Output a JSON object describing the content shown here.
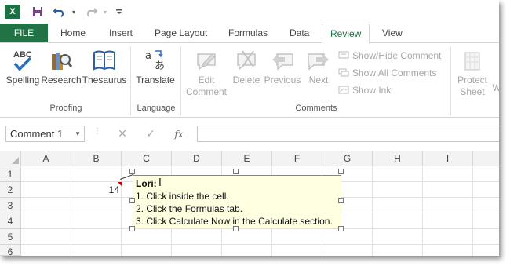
{
  "qat": {
    "app_logo": "X",
    "icons": [
      "save-icon",
      "undo-icon",
      "redo-icon",
      "customize-icon"
    ]
  },
  "tabs": {
    "file": "FILE",
    "items": [
      "Home",
      "Insert",
      "Page Layout",
      "Formulas",
      "Data",
      "Review",
      "View"
    ],
    "active": "Review"
  },
  "ribbon": {
    "proofing": {
      "label": "Proofing",
      "spelling": "Spelling",
      "research": "Research",
      "thesaurus": "Thesaurus",
      "abc": "ABC"
    },
    "language": {
      "label": "Language",
      "translate": "Translate"
    },
    "comments": {
      "label": "Comments",
      "edit_line1": "Edit",
      "edit_line2": "Comment",
      "delete": "Delete",
      "previous": "Previous",
      "next": "Next",
      "show_hide": "Show/Hide Comment",
      "show_all": "Show All Comments",
      "show_ink": "Show Ink"
    },
    "changes": {
      "protect_line1": "Protect",
      "protect_line2": "Sheet",
      "partial": "W"
    }
  },
  "formula_bar": {
    "name_box": "Comment 1",
    "cancel": "✕",
    "enter": "✓",
    "fx": "fx",
    "value": ""
  },
  "grid": {
    "columns": [
      "A",
      "B",
      "C",
      "D",
      "E",
      "F",
      "G",
      "H",
      "I"
    ],
    "rows": [
      "1",
      "2",
      "3",
      "4",
      "5",
      "6"
    ],
    "b2_value": "14"
  },
  "comment": {
    "author": "Lori:",
    "lines": [
      "1. Click inside the cell.",
      "2. Click the Formulas tab.",
      "3. Click Calculate Now in the Calculate section."
    ]
  },
  "colors": {
    "excel_green": "#217346",
    "comment_bg": "#ffffe1",
    "disabled_text": "#a6a6a6"
  }
}
